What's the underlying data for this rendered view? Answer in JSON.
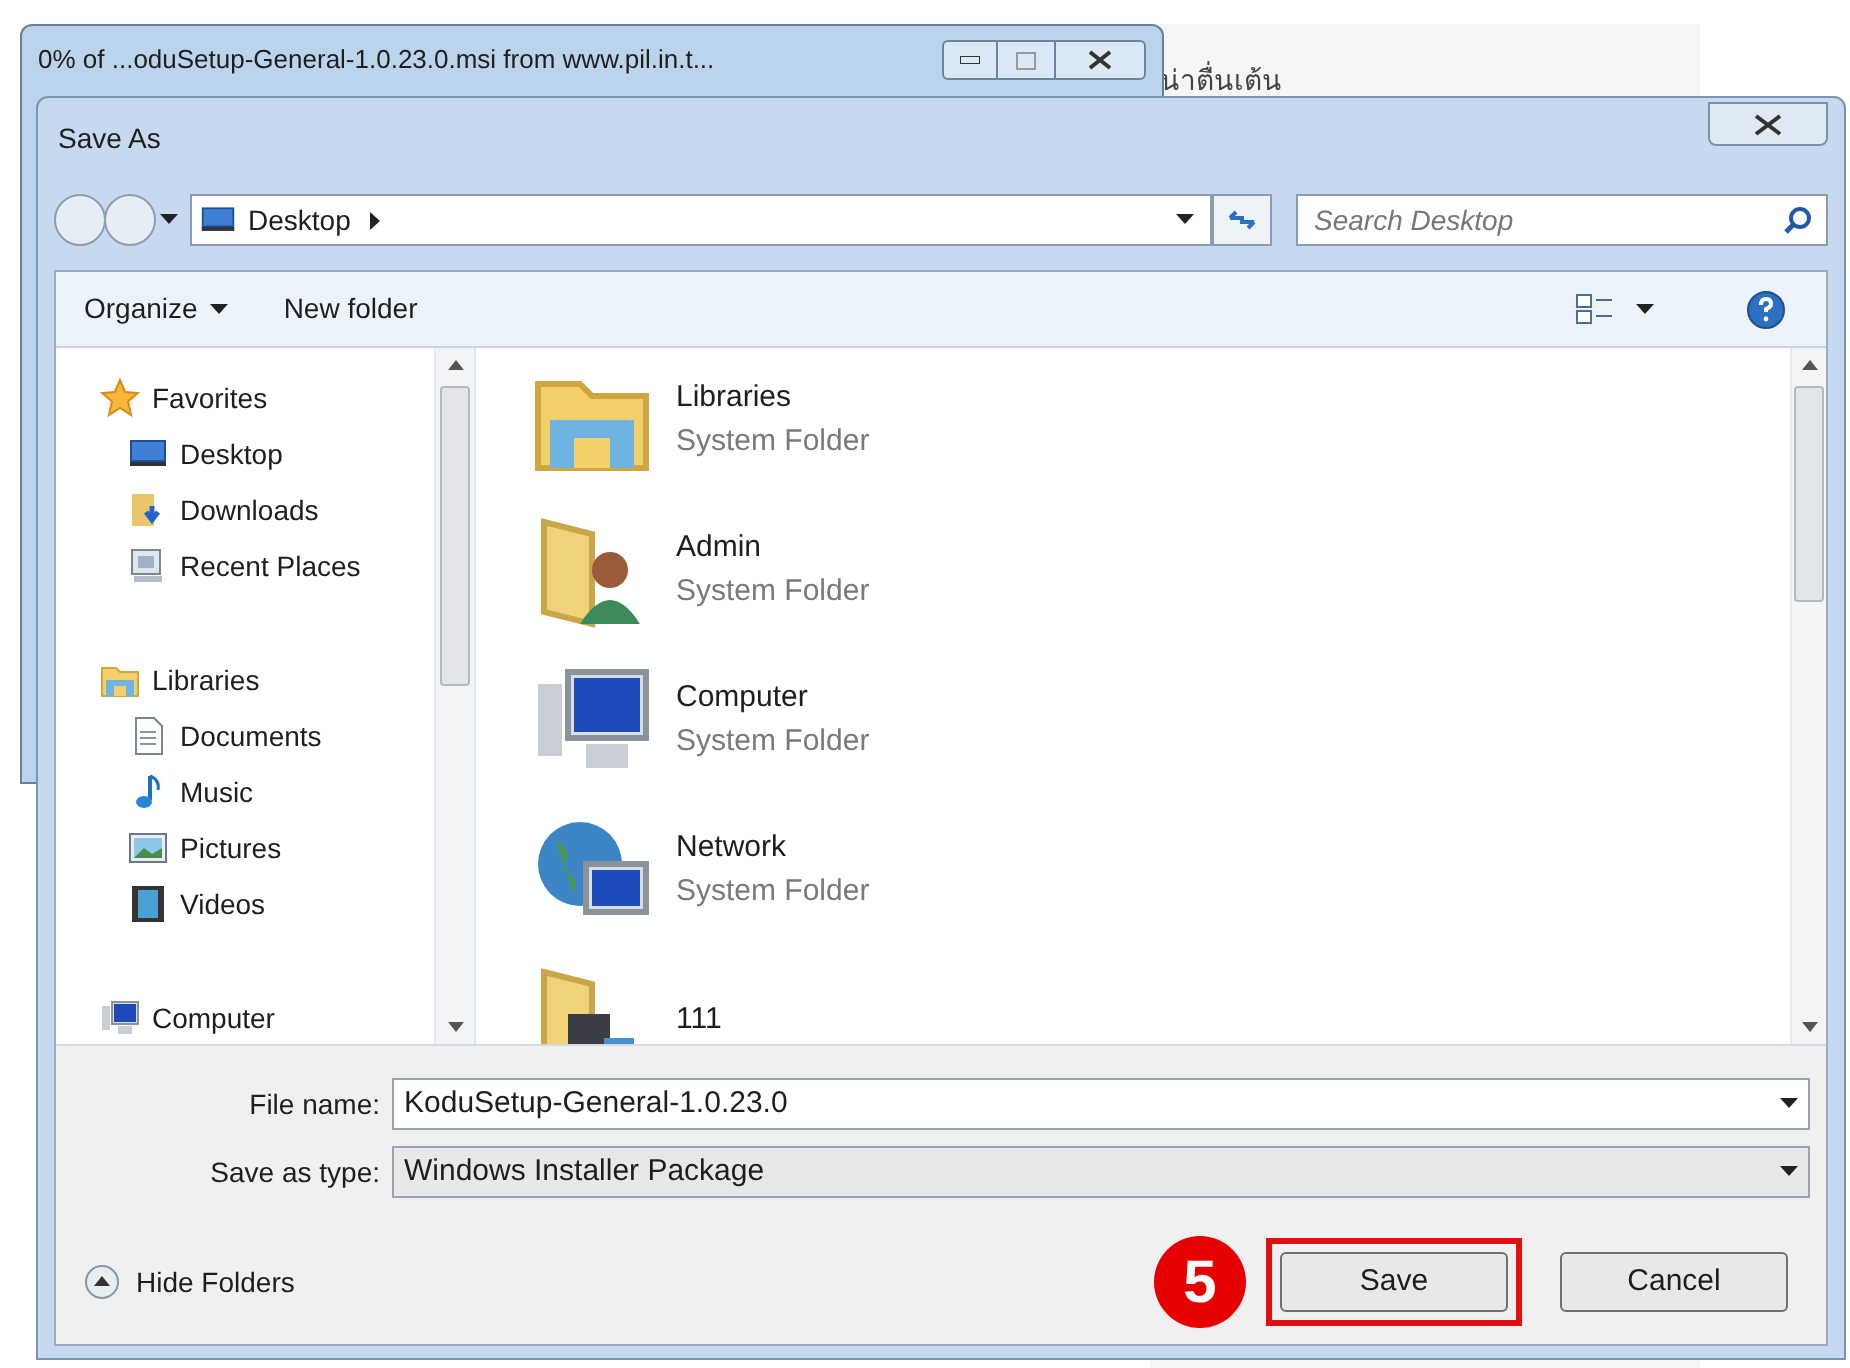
{
  "background_window": {
    "title": "0% of ...oduSetup-General-1.0.23.0.msi from www.pil.in.t..."
  },
  "background_text": "น่าตื่นเต้น",
  "dialog": {
    "title": "Save As",
    "breadcrumb": "Desktop",
    "search": {
      "placeholder": "Search Desktop"
    },
    "toolbar": [
      {
        "label": "Organize",
        "dropdown": true
      },
      {
        "label": "New folder",
        "dropdown": false
      }
    ],
    "nav_groups": [
      {
        "label": "Favorites",
        "kind": "star",
        "children": [
          {
            "label": "Desktop",
            "kind": "desktop"
          },
          {
            "label": "Downloads",
            "kind": "downloads"
          },
          {
            "label": "Recent Places",
            "kind": "recent"
          }
        ]
      },
      {
        "label": "Libraries",
        "kind": "library",
        "children": [
          {
            "label": "Documents",
            "kind": "documents"
          },
          {
            "label": "Music",
            "kind": "music"
          },
          {
            "label": "Pictures",
            "kind": "pictures"
          },
          {
            "label": "Videos",
            "kind": "videos"
          }
        ]
      },
      {
        "label": "Computer",
        "kind": "computer"
      }
    ],
    "items": [
      {
        "name": "Libraries",
        "type": "System Folder",
        "kind": "library"
      },
      {
        "name": "Admin",
        "type": "System Folder",
        "kind": "user"
      },
      {
        "name": "Computer",
        "type": "System Folder",
        "kind": "computer"
      },
      {
        "name": "Network",
        "type": "System Folder",
        "kind": "network"
      },
      {
        "name": "111",
        "kind": "folder"
      }
    ],
    "file_name": {
      "label": "File name:",
      "value": "KoduSetup-General-1.0.23.0"
    },
    "save_type": {
      "label": "Save as type:",
      "value": "Windows Installer Package"
    },
    "hide_folders": "Hide Folders",
    "step_badge": "5",
    "buttons": [
      {
        "label": "Save",
        "highlighted": true
      },
      {
        "label": "Cancel",
        "highlighted": false
      }
    ]
  }
}
